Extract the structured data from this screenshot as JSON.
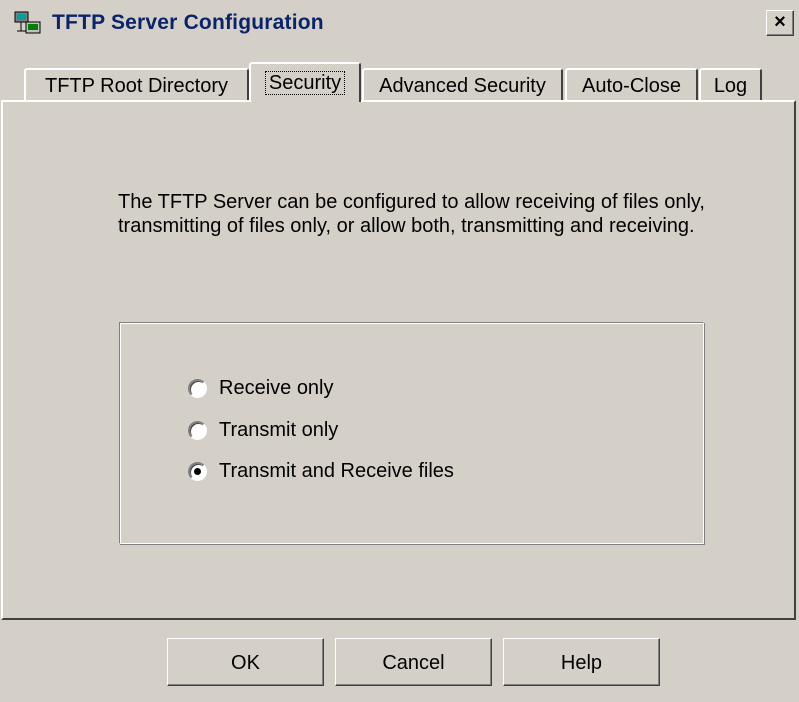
{
  "window": {
    "title": "TFTP Server Configuration",
    "close_glyph": "×",
    "icon": "network-computers-icon"
  },
  "tabs": [
    {
      "label": "TFTP Root Directory",
      "active": false
    },
    {
      "label": "Security",
      "active": true
    },
    {
      "label": "Advanced Security",
      "active": false
    },
    {
      "label": "Auto-Close",
      "active": false
    },
    {
      "label": "Log",
      "active": false
    }
  ],
  "security": {
    "description": "The TFTP Server can be configured to allow receiving of files only, transmitting of files only, or allow both, transmitting and receiving.",
    "options": [
      {
        "label": "Receive only",
        "checked": false
      },
      {
        "label": "Transmit only",
        "checked": false
      },
      {
        "label": "Transmit and Receive files",
        "checked": true
      }
    ]
  },
  "buttons": {
    "ok": "OK",
    "cancel": "Cancel",
    "help": "Help"
  },
  "colors": {
    "face": "#d4d0c8",
    "title_text": "#0a246a"
  }
}
